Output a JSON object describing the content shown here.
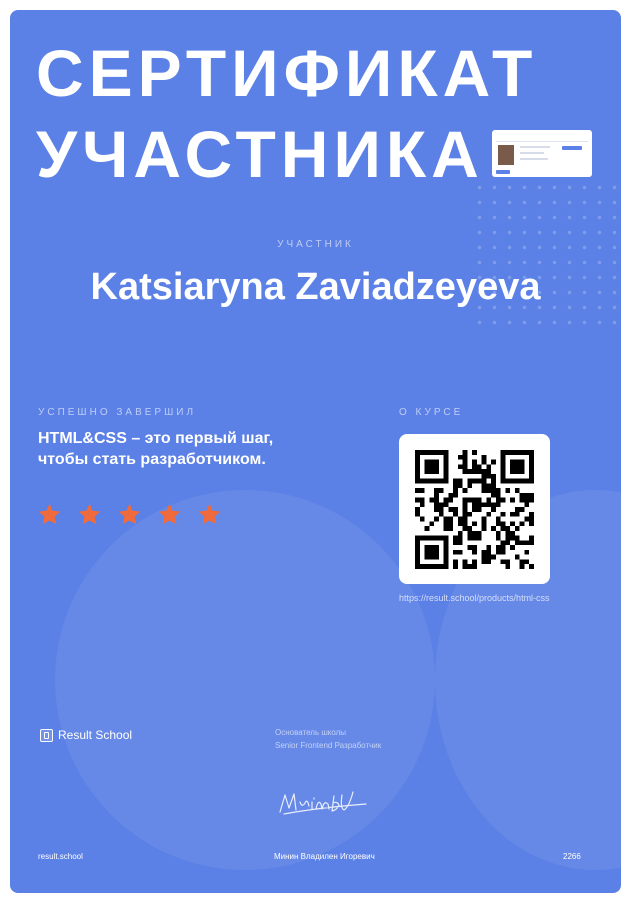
{
  "title": {
    "line1": "СЕРТИФИКАТ",
    "line2": "УЧАСТНИКА"
  },
  "participant": {
    "caption": "УЧАСТНИК",
    "name": "Katsiaryna Zaviadzeyeva"
  },
  "course": {
    "completed_caption": "УСПЕШНО ЗАВЕРШИЛ",
    "description": "HTML&CSS – это первый шаг, чтобы стать разработчиком.",
    "rating": {
      "stars": 5,
      "max": 5
    }
  },
  "about": {
    "caption": "О КУРСЕ",
    "url": "https://result.school/products/html-css"
  },
  "brand": {
    "logo_text": "Result School",
    "site": "result.school"
  },
  "founder": {
    "role": "Основатель школы",
    "title": "Senior Frontend Разработчик",
    "signature": "Минин ВИ",
    "name": "Минин Владилен Игоревич"
  },
  "certificate_number": "2266",
  "colors": {
    "background": "#5b80e6",
    "accent_star": "#ef6a3c",
    "text": "#ffffff"
  }
}
